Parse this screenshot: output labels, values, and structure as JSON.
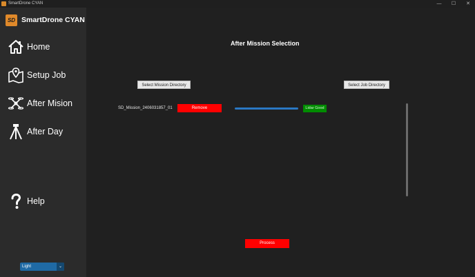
{
  "window": {
    "title": "SmartDrone CYAN",
    "controls": {
      "minimize": "—",
      "maximize": "☐",
      "close": "✕"
    }
  },
  "brand": {
    "logo_text": "SD",
    "name": "SmartDrone CYAN"
  },
  "nav": [
    {
      "label": "Home",
      "icon": "home-icon"
    },
    {
      "label": "Setup Job",
      "icon": "map-pin-icon"
    },
    {
      "label": "After Mision",
      "icon": "drone-icon"
    },
    {
      "label": "After Day",
      "icon": "tripod-icon"
    },
    {
      "label": "Help",
      "icon": "question-icon"
    }
  ],
  "theme": {
    "value": "Light"
  },
  "main": {
    "title": "After Mission Selection",
    "select_mission_dir": "Select Mission Directory",
    "select_job_dir": "Select Job Directory",
    "mission": {
      "name": "SD_Mission_2406031857_01",
      "remove_label": "Remove",
      "status": "Lidar Good",
      "progress": 1.0
    },
    "process_label": "Process"
  },
  "colors": {
    "accent": "#1f6aa5",
    "danger": "#ff0000",
    "ok": "#008c00",
    "progress": "#2a78c4"
  }
}
